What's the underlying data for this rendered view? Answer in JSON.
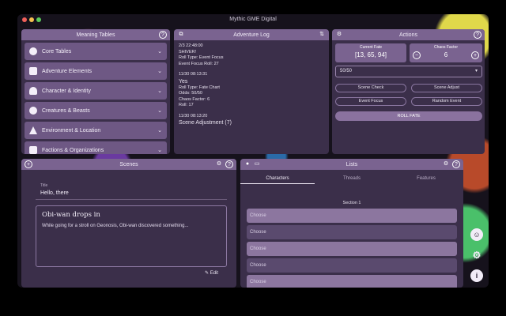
{
  "window": {
    "title": "Mythic GME Digital"
  },
  "meaning_tables": {
    "title": "Meaning Tables",
    "items": [
      {
        "label": "Core Tables",
        "icon": "dice-icon"
      },
      {
        "label": "Adventure Elements",
        "icon": "scroll-icon"
      },
      {
        "label": "Character & Identity",
        "icon": "person-icon"
      },
      {
        "label": "Creatures & Beasts",
        "icon": "paw-icon"
      },
      {
        "label": "Environment & Location",
        "icon": "mountain-icon"
      },
      {
        "label": "Factions & Organizations",
        "icon": "group-icon"
      }
    ]
  },
  "adventure_log": {
    "title": "Adventure Log",
    "entries": [
      {
        "time": "2/3 22:48:00",
        "headline": "SHIVER!",
        "lines": [
          "Roll Type: Event Focus",
          "Event Focus Roll: 27"
        ]
      },
      {
        "time": "11/30 08:13:31",
        "headline": "Yes",
        "lines": [
          "Roll Type: Fate Chart",
          "Odds: 50/50",
          "Chaos Factor: 6",
          "Roll: 17"
        ]
      },
      {
        "time": "11/30 08:13:20",
        "headline": "Scene Adjustment (7)",
        "lines": []
      }
    ]
  },
  "actions": {
    "title": "Actions",
    "current_fate_label": "Current Fate",
    "current_fate_value": "[13, 65, 94]",
    "chaos_factor_label": "Chaos Factor",
    "chaos_factor_value": "6",
    "odds_selected": "50/50",
    "buttons": [
      "Scene Check",
      "Scene Adjust",
      "Event Focus",
      "Random Event"
    ],
    "roll_fate": "ROLL FATE"
  },
  "scenes": {
    "title": "Scenes",
    "title_field_label": "Title",
    "title_field_value": "Hello, there",
    "card_title": "Obi-wan drops in",
    "card_body": "While going for a stroll on Geonosis, Obi-wan discovered something...",
    "edit_label": "Edit"
  },
  "lists": {
    "title": "Lists",
    "tabs": [
      "Characters",
      "Threads",
      "Features"
    ],
    "section": "Section 1",
    "choose_label": "Choose"
  }
}
